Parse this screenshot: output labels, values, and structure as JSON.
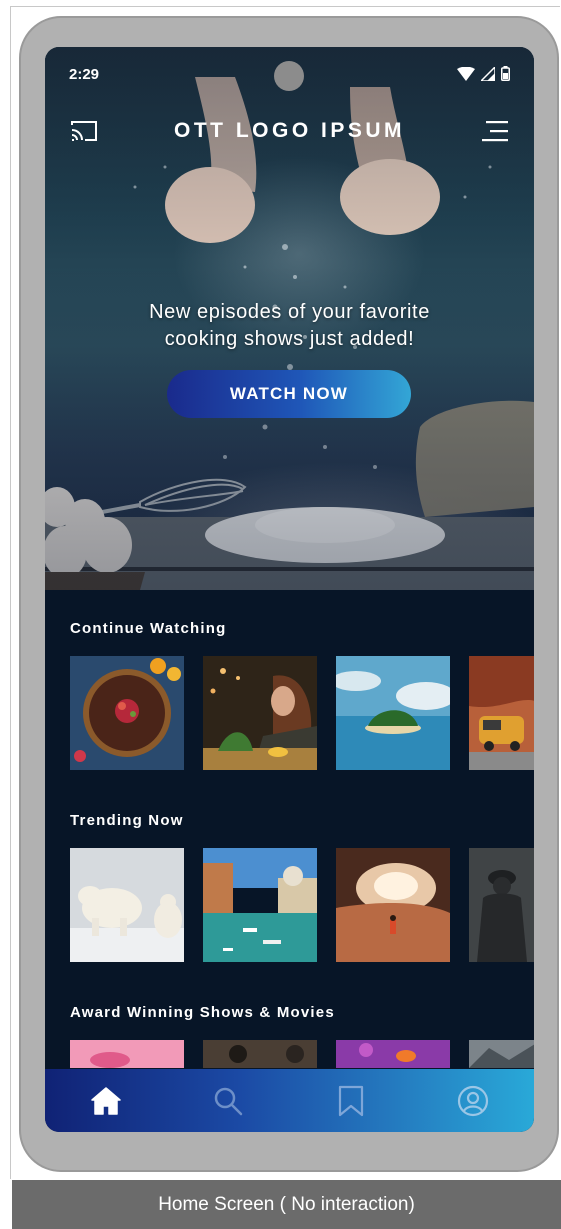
{
  "status": {
    "time": "2:29"
  },
  "header": {
    "logo": "OTT LOGO IPSUM"
  },
  "hero": {
    "headline_line1": "New episodes of your favorite",
    "headline_line2": "cooking shows just added!",
    "cta_label": "WATCH NOW"
  },
  "sections": [
    {
      "title": "Continue Watching",
      "items": [
        "chocolate-tart",
        "woman-at-cafe-table",
        "tropical-island",
        "orange-van-desert"
      ]
    },
    {
      "title": "Trending Now",
      "items": [
        "polar-bears",
        "venice-canal",
        "cave-explorer",
        "shadowy-figure"
      ]
    },
    {
      "title": "Award Winning Shows & Movies",
      "items": [
        "pink-flamingos",
        "dark-interior-couple",
        "coral-reef-fish",
        "mountain-landscape"
      ]
    }
  ],
  "bottom_nav": {
    "items": [
      "home-icon",
      "search-icon",
      "bookmark-icon",
      "profile-icon"
    ],
    "active": "home-icon"
  },
  "caption": "Home Screen ( No interaction)",
  "colors": {
    "screen_bg": "#071527",
    "cta_start": "#1a2a8c",
    "cta_end": "#33a6d6",
    "nav_start": "#102275",
    "nav_end": "#29a9d8"
  }
}
